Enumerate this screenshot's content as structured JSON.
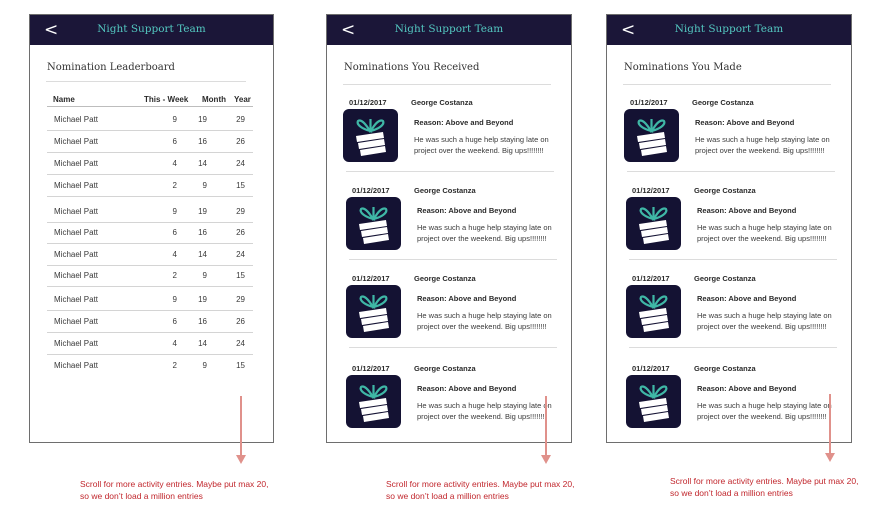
{
  "app": {
    "header_title": "Night Support Team",
    "back_glyph": "<"
  },
  "leaderboard": {
    "title": "Nomination Leaderboard",
    "columns": {
      "name": "Name",
      "week": "This  -  Week",
      "month": "Month",
      "year": "Year"
    },
    "rows": [
      {
        "name": "Michael Patt",
        "week": "9",
        "month": "19",
        "year": "29"
      },
      {
        "name": "Michael Patt",
        "week": "6",
        "month": "16",
        "year": "26"
      },
      {
        "name": "Michael Patt",
        "week": "4",
        "month": "14",
        "year": "24"
      },
      {
        "name": "Michael Patt",
        "week": "2",
        "month": "9",
        "year": "15"
      },
      {
        "name": "Michael Patt",
        "week": "9",
        "month": "19",
        "year": "29"
      },
      {
        "name": "Michael Patt",
        "week": "6",
        "month": "16",
        "year": "26"
      },
      {
        "name": "Michael Patt",
        "week": "4",
        "month": "14",
        "year": "24"
      },
      {
        "name": "Michael Patt",
        "week": "2",
        "month": "9",
        "year": "15"
      },
      {
        "name": "Michael Patt",
        "week": "9",
        "month": "19",
        "year": "29"
      },
      {
        "name": "Michael Patt",
        "week": "6",
        "month": "16",
        "year": "26"
      },
      {
        "name": "Michael Patt",
        "week": "4",
        "month": "14",
        "year": "24"
      },
      {
        "name": "Michael Patt",
        "week": "2",
        "month": "9",
        "year": "15"
      }
    ]
  },
  "received": {
    "title": "Nominations You Received",
    "items": [
      {
        "date": "01/12/2017",
        "person": "George Costanza",
        "reason": "Reason: Above and Beyond",
        "message": "He was such a huge help staying late on project over the weekend. Big ups!!!!!!!!",
        "icon": "gift-icon"
      },
      {
        "date": "01/12/2017",
        "person": "George Costanza",
        "reason": "Reason: Above and Beyond",
        "message": "He was such a huge help staying late on project over the weekend. Big ups!!!!!!!!",
        "icon": "gift-icon"
      },
      {
        "date": "01/12/2017",
        "person": "George Costanza",
        "reason": "Reason: Above and Beyond",
        "message": "He was such a huge help staying late on project over the weekend. Big ups!!!!!!!!",
        "icon": "gift-icon"
      },
      {
        "date": "01/12/2017",
        "person": "George Costanza",
        "reason": "Reason: Above and Beyond",
        "message": "He was such a huge help staying late on project over the weekend. Big ups!!!!!!!!",
        "icon": "gift-icon"
      }
    ]
  },
  "made": {
    "title": "Nominations You Made",
    "items": [
      {
        "date": "01/12/2017",
        "person": "George Costanza",
        "reason": "Reason: Above and Beyond",
        "message": "He was such a huge help staying late on project over the weekend. Big ups!!!!!!!!",
        "icon": "gift-icon"
      },
      {
        "date": "01/12/2017",
        "person": "George Costanza",
        "reason": "Reason: Above and Beyond",
        "message": "He was such a huge help staying late on project over the weekend. Big ups!!!!!!!!",
        "icon": "gift-icon"
      },
      {
        "date": "01/12/2017",
        "person": "George Costanza",
        "reason": "Reason: Above and Beyond",
        "message": "He was such a huge help staying late on project over the weekend. Big ups!!!!!!!!",
        "icon": "gift-icon"
      },
      {
        "date": "01/12/2017",
        "person": "George Costanza",
        "reason": "Reason: Above and Beyond",
        "message": "He was such a huge help staying late on project over the weekend. Big ups!!!!!!!!",
        "icon": "gift-icon"
      }
    ]
  },
  "annotation": {
    "scroll_note": "Scroll for more activity entries. Maybe put max 20, so we don’t load a million entries"
  },
  "colors": {
    "header_bg": "#1b1638",
    "header_title": "#53c7c0",
    "icon_bg": "#141233",
    "icon_teal": "#3fb7a6",
    "note_red": "#c1272d",
    "arrow_pink": "#e0918b"
  }
}
